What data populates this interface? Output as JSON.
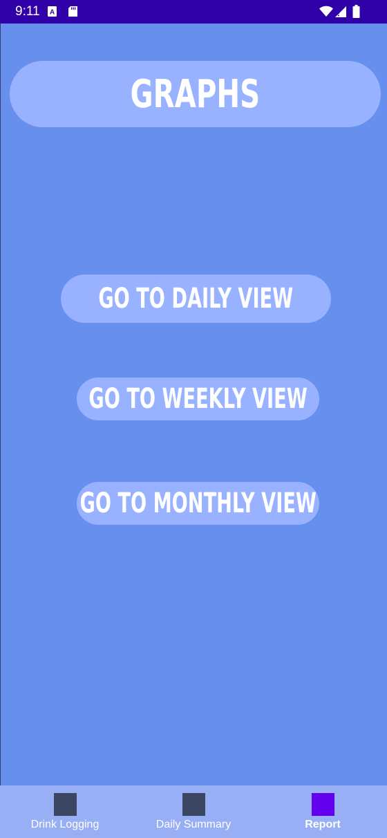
{
  "status_bar": {
    "time": "9:11",
    "background_color": "#3000a8",
    "left_icons": [
      "accessibility-a-icon",
      "sd-card-icon"
    ],
    "right_icons": [
      "wifi-icon",
      "signal-icon",
      "battery-icon"
    ]
  },
  "screen": {
    "background_color": "#6790ee",
    "title": "GRAPHS",
    "pill_color": "#98b2ff"
  },
  "buttons": {
    "daily_label": "GO TO DAILY VIEW",
    "weekly_label": "GO TO WEEKLY VIEW",
    "monthly_label": "GO TO MONTHLY VIEW"
  },
  "bottom_nav": {
    "background_color": "#98aef5",
    "items": [
      {
        "label": "Drink Logging",
        "icon_color": "#3b4662",
        "active": false
      },
      {
        "label": "Daily Summary",
        "icon_color": "#3b4662",
        "active": false
      },
      {
        "label": "Report",
        "icon_color": "#6200ee",
        "active": true
      }
    ]
  }
}
